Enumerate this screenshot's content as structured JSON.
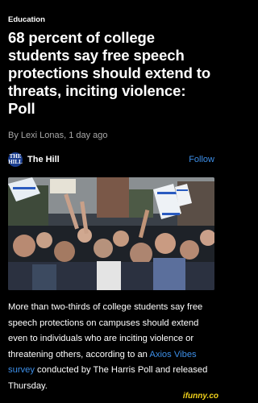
{
  "article": {
    "category": "Education",
    "headline": "68 percent of college students say free speech protections should extend to threats, inciting violence: Poll",
    "byline": "By Lexi Lonas, 1 day ago",
    "source": {
      "name": "The Hill",
      "logo_text": "THE HILL",
      "follow_label": "Follow",
      "logo_color": "#1a3d8f"
    },
    "hero_image": {
      "description_icon": "photo-icon"
    },
    "body": {
      "part1": "More than two-thirds of college students say free speech protections on campuses should extend even to individuals who are inciting violence or threatening others, according to an ",
      "link_text": "Axios Vibes survey",
      "part2": " conducted by The Harris Poll and released Thursday."
    }
  },
  "watermark": "ifunny.co",
  "colors": {
    "background": "#000000",
    "link": "#3d8fe8",
    "watermark": "#f2d21b"
  }
}
